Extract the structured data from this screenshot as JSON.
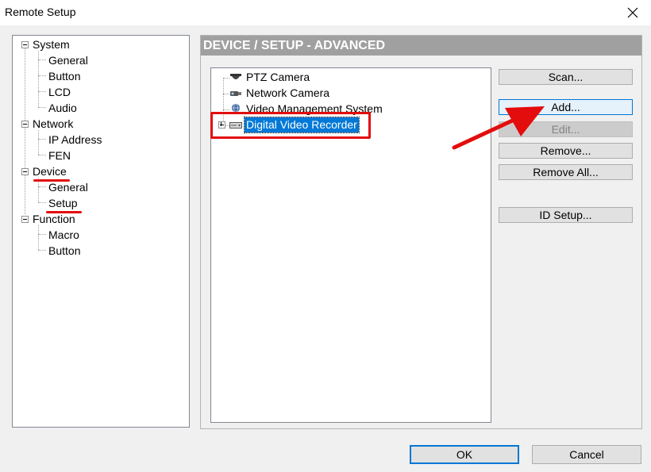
{
  "window": {
    "title": "Remote Setup"
  },
  "left_tree": {
    "items": [
      {
        "label": "System",
        "expandable": true
      },
      {
        "label": "General"
      },
      {
        "label": "Button"
      },
      {
        "label": "LCD"
      },
      {
        "label": "Audio"
      },
      {
        "label": "Network",
        "expandable": true
      },
      {
        "label": "IP Address"
      },
      {
        "label": "FEN"
      },
      {
        "label": "Device",
        "expandable": true
      },
      {
        "label": "General"
      },
      {
        "label": "Setup"
      },
      {
        "label": "Function",
        "expandable": true
      },
      {
        "label": "Macro"
      },
      {
        "label": "Button"
      }
    ]
  },
  "panel": {
    "header": "DEVICE / SETUP - ADVANCED",
    "devices": [
      {
        "label": "PTZ Camera",
        "icon": "ptz-camera-icon"
      },
      {
        "label": "Network Camera",
        "icon": "network-camera-icon"
      },
      {
        "label": "Video Management System",
        "icon": "vms-globe-icon"
      },
      {
        "label": "Digital Video Recorder",
        "icon": "dvr-icon",
        "selected": true
      }
    ],
    "buttons": {
      "scan": "Scan...",
      "add": "Add...",
      "edit": "Edit...",
      "remove": "Remove...",
      "remove_all": "Remove All...",
      "id_setup": "ID Setup..."
    }
  },
  "footer": {
    "ok": "OK",
    "cancel": "Cancel"
  },
  "colors": {
    "annotation_red": "#e30d0d",
    "selection_blue": "#0078d7",
    "header_gray": "#a0a0a0"
  }
}
